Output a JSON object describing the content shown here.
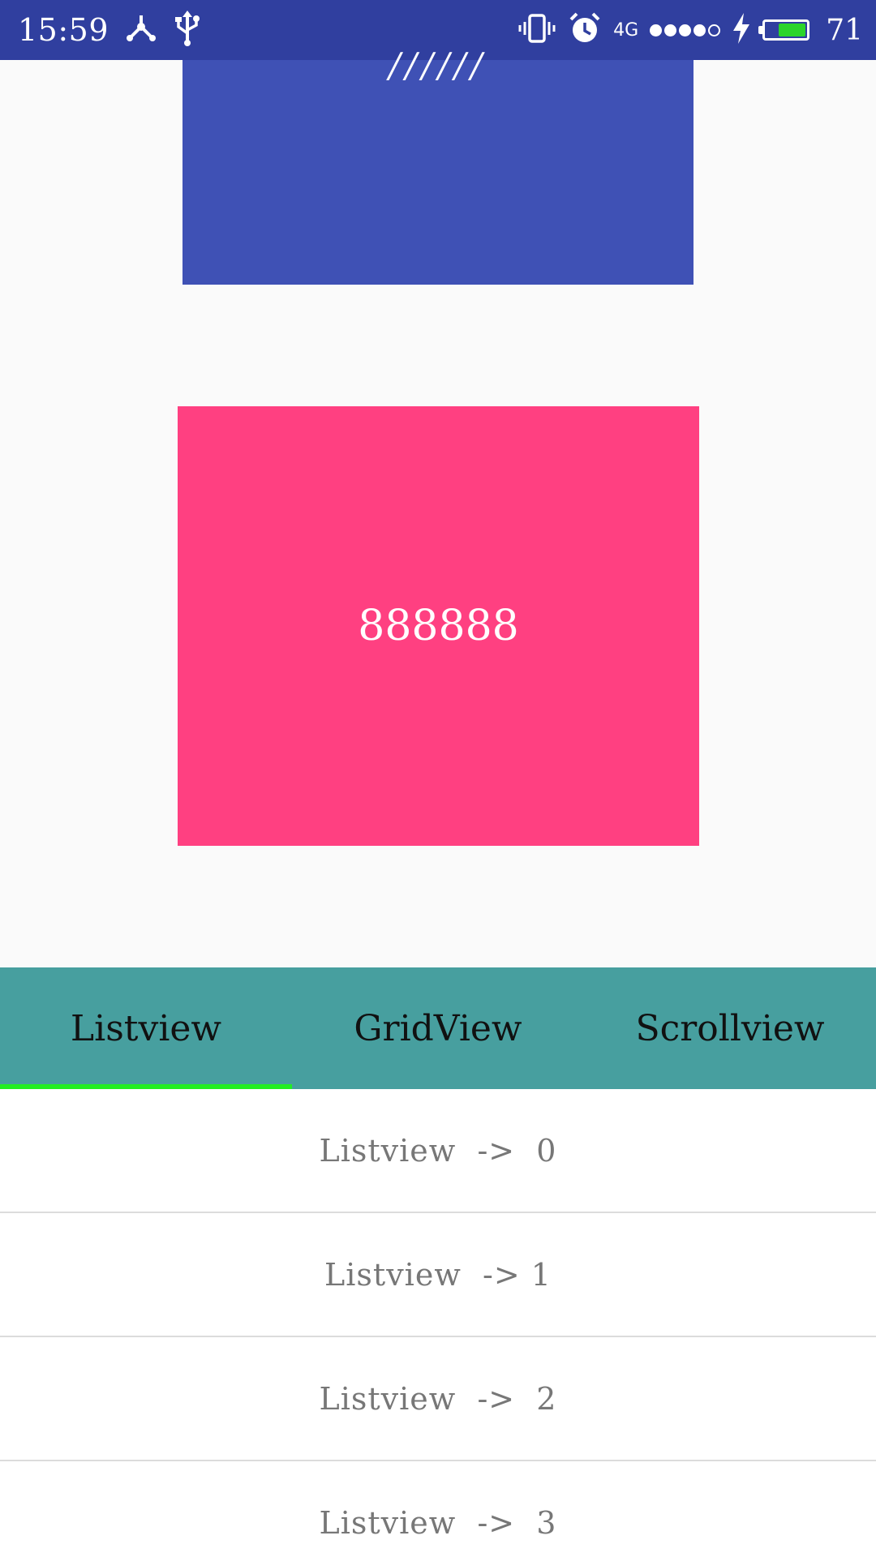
{
  "status_bar": {
    "time": "15:59",
    "network": "4G",
    "battery_level": "71",
    "battery_fraction": 0.71,
    "signal_bars_filled": 4,
    "signal_bars_total": 5,
    "bg_color": "#303f9f"
  },
  "cards": {
    "blue": {
      "text": "//////",
      "color": "#3f51b5"
    },
    "pink": {
      "text": "888888",
      "color": "#ff4081"
    }
  },
  "tabs": {
    "items": [
      {
        "label": "Listview"
      },
      {
        "label": "GridView"
      },
      {
        "label": "Scrollview"
      }
    ],
    "selected_index": 0,
    "bar_color": "#479f9f",
    "indicator_color": "#22ee22"
  },
  "list": {
    "items": [
      {
        "label": "Listview  ->  0"
      },
      {
        "label": "Listview  -> 1"
      },
      {
        "label": "Listview  ->  2"
      },
      {
        "label": "Listview  ->  3"
      }
    ]
  }
}
